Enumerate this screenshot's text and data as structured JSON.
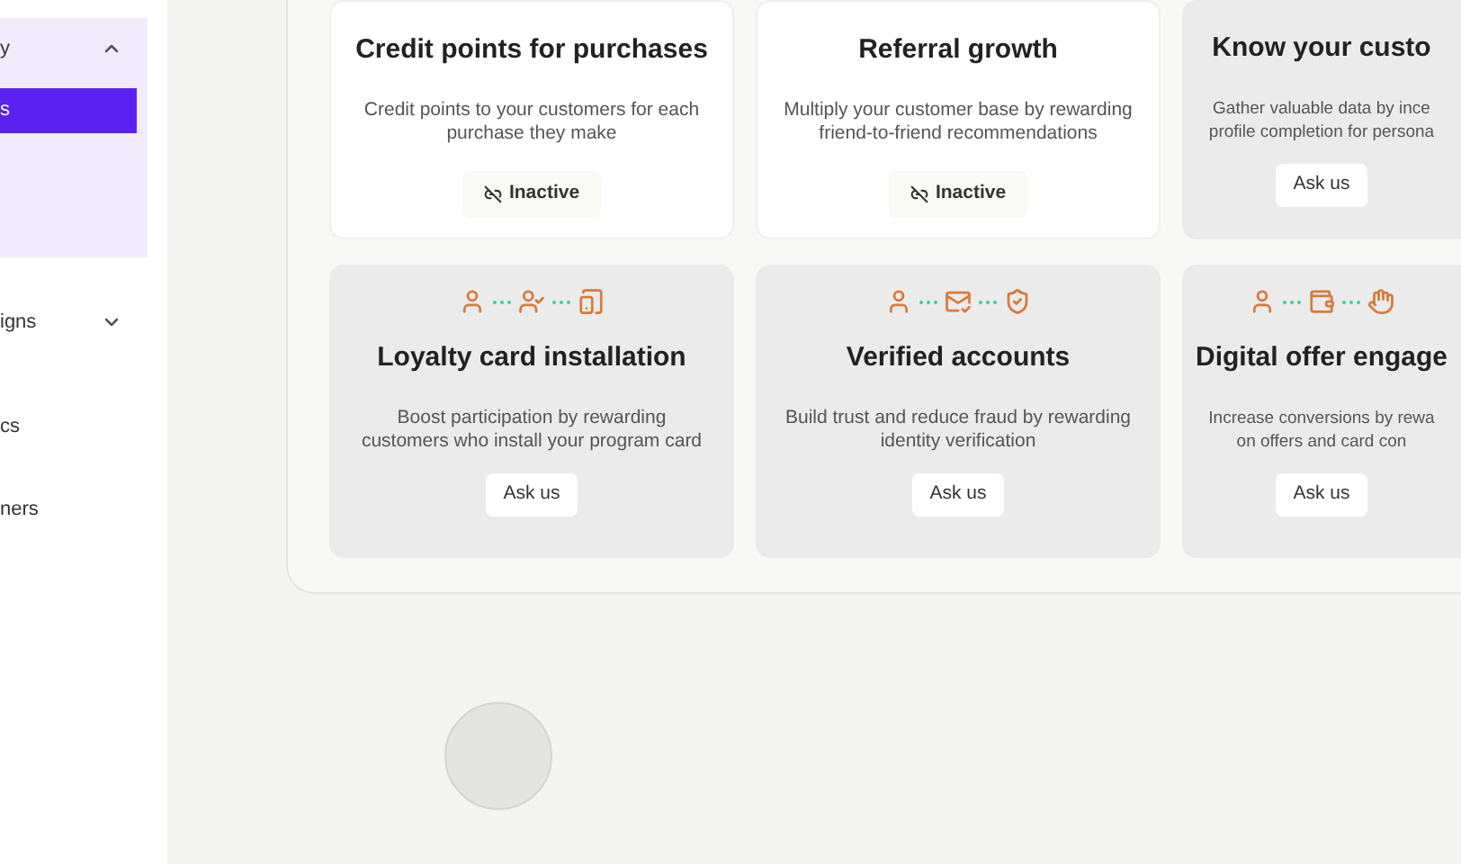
{
  "sidebar": {
    "groups": [
      {
        "label": "y",
        "expanded": true,
        "children": [
          {
            "label": "s",
            "selected": true
          }
        ]
      },
      {
        "label": "igns",
        "expanded": false
      }
    ],
    "items": [
      {
        "label": "cs",
        "selected": false
      },
      {
        "label": "ners",
        "selected": false
      }
    ]
  },
  "cards": [
    {
      "title": "Credit points for purchases",
      "description": [
        "Credit points to your customers for each",
        "purchase they make"
      ],
      "kind": "inactive",
      "action": "Inactive"
    },
    {
      "title": "Referral growth",
      "description": [
        "Multiply your customer base by rewarding",
        "friend-to-friend recommendations"
      ],
      "kind": "inactive",
      "action": "Inactive"
    },
    {
      "title": "Know your custo",
      "description": [
        "Gather valuable data by ince",
        "profile completion for persona"
      ],
      "kind": "ask",
      "action": "Ask us"
    },
    {
      "title": "Loyalty card installation",
      "description": [
        "Boost participation by rewarding",
        "customers who install your program card"
      ],
      "kind": "ask",
      "action": "Ask us"
    },
    {
      "title": "Verified accounts",
      "description": [
        "Build trust and reduce fraud by rewarding",
        "identity verification"
      ],
      "kind": "ask",
      "action": "Ask us"
    },
    {
      "title": "Digital offer engage",
      "description": [
        "Increase conversions by rewa",
        "on offers and card con"
      ],
      "kind": "ask",
      "action": "Ask us"
    }
  ]
}
